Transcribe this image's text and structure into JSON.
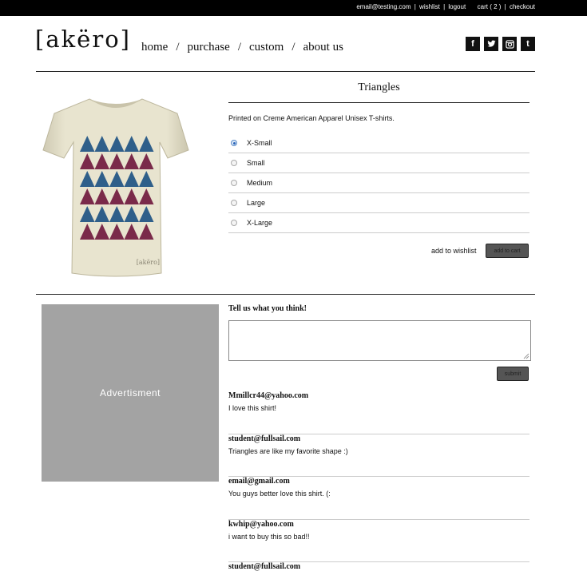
{
  "topbar": {
    "email": "email@testing.com",
    "wishlist": "wishlist",
    "logout": "logout",
    "cart": "cart ( 2 )",
    "checkout": "checkout",
    "separator": "|"
  },
  "header": {
    "logo": "[akëro]",
    "nav": [
      "home",
      "purchase",
      "custom",
      "about us"
    ],
    "nav_separator": "/",
    "social": [
      {
        "icon": "facebook-icon",
        "glyph": "f"
      },
      {
        "icon": "twitter-icon",
        "glyph": "t"
      },
      {
        "icon": "instagram-icon",
        "glyph": "◘"
      },
      {
        "icon": "tumblr-icon",
        "glyph": "t"
      }
    ]
  },
  "product": {
    "title": "Triangles",
    "description": "Printed on Creme American Apparel Unisex T-shirts.",
    "sizes": [
      "X-Small",
      "Small",
      "Medium",
      "Large",
      "X-Large"
    ],
    "selected_size": "X-Small",
    "wishlist_label": "add to wishlist",
    "add_to_cart_label": "add to cart",
    "shirt_print_label": "[akëro]",
    "colors": {
      "shirt": "#e6e2cc",
      "triangle_blue": "#2f5f8a",
      "triangle_maroon": "#7a2a4a"
    }
  },
  "advertisement": {
    "label": "Advertisment"
  },
  "feedback": {
    "heading": "Tell us what you think!",
    "textarea_value": "",
    "submit_label": "submit",
    "comments": [
      {
        "author": "Mmillcr44@yahoo.com",
        "text": "I love this shirt!"
      },
      {
        "author": "student@fullsail.com",
        "text": "Triangles are like my favorite shape :)"
      },
      {
        "author": "email@gmail.com",
        "text": "You guys better love this shirt. (:"
      },
      {
        "author": "kwhip@yahoo.com",
        "text": "i want to buy this so bad!!"
      },
      {
        "author": "student@fullsail.com",
        "text": ""
      }
    ]
  }
}
